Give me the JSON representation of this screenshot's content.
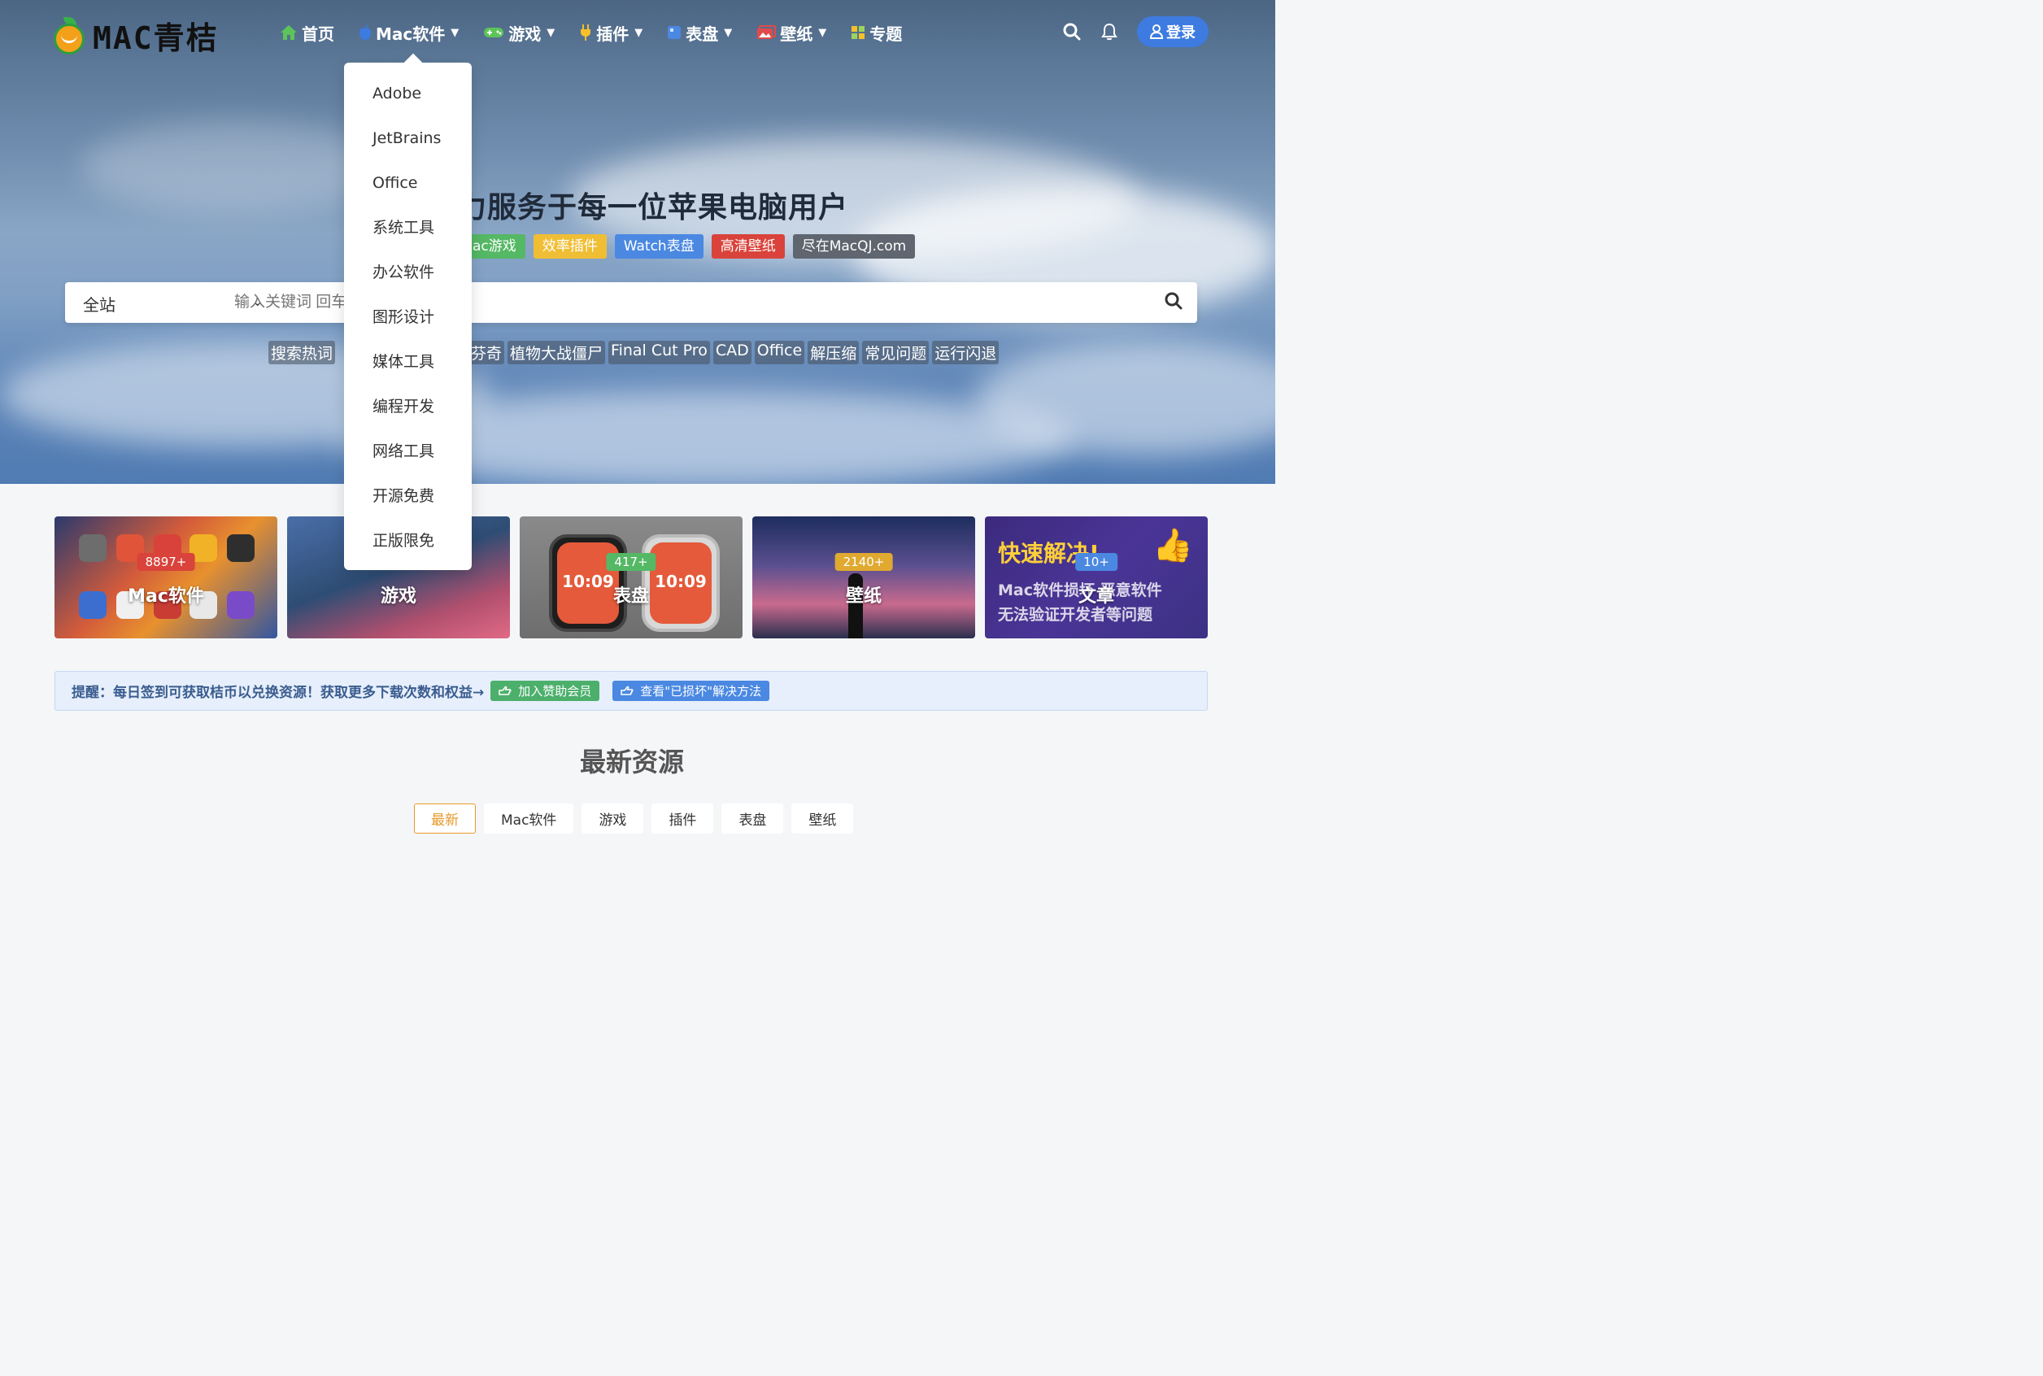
{
  "brand": {
    "name": "MAC青桔"
  },
  "nav": {
    "items": [
      {
        "label": "首页",
        "icon": "home-icon",
        "color": "#5cc55a",
        "has_dropdown": false
      },
      {
        "label": "Mac软件",
        "icon": "apple-icon",
        "color": "#3d7be0",
        "has_dropdown": true
      },
      {
        "label": "游戏",
        "icon": "gamepad-icon",
        "color": "#5cc55a",
        "has_dropdown": true
      },
      {
        "label": "插件",
        "icon": "plug-icon",
        "color": "#f5c02a",
        "has_dropdown": true
      },
      {
        "label": "表盘",
        "icon": "watch-icon",
        "color": "#4a88e2",
        "has_dropdown": true
      },
      {
        "label": "壁纸",
        "icon": "wallpaper-icon",
        "color": "#e04a4a",
        "has_dropdown": true
      },
      {
        "label": "专题",
        "icon": "grid-icon",
        "color": "#f5c02a",
        "has_dropdown": false
      }
    ],
    "login_label": "登录"
  },
  "dropdown": {
    "items": [
      "Adobe",
      "JetBrains",
      "Office",
      "系统工具",
      "办公软件",
      "图形设计",
      "媒体工具",
      "编程开发",
      "网络工具",
      "开源免费",
      "正版限免"
    ]
  },
  "hero": {
    "title_visible": "全力服务于每一位苹果电脑用户",
    "tags": [
      {
        "label": "ac游戏",
        "color": "#55b865"
      },
      {
        "label": "效率插件",
        "color": "#f0be34"
      },
      {
        "label": "Watch表盘",
        "color": "#4a88e2"
      },
      {
        "label": "高清壁纸",
        "color": "#d9433b"
      },
      {
        "label": "尽在MacQJ.com",
        "color": "#5f6670"
      }
    ]
  },
  "search": {
    "scope": "全站",
    "placeholder": "输入关键词 回车"
  },
  "hotwords": {
    "label": "搜索热词",
    "items": [
      "芬奇",
      "植物大战僵尸",
      "Final Cut Pro",
      "CAD",
      "Office",
      "解压缩",
      "常见问题",
      "运行闪退"
    ]
  },
  "categories": [
    {
      "label": "Mac软件",
      "count": "8897+",
      "badge_color": "#d9433b"
    },
    {
      "label": "游戏",
      "count": "",
      "badge_color": ""
    },
    {
      "label": "表盘",
      "count": "417+",
      "badge_color": "#55b865"
    },
    {
      "label": "壁纸",
      "count": "2140+",
      "badge_color": "#e0a930"
    },
    {
      "label": "文章",
      "count": "10+",
      "badge_color": "#4a88e2"
    }
  ],
  "card_watch": {
    "time": "10:09"
  },
  "card_article": {
    "headline": "快速解决!",
    "line1": "Mac软件损坏 恶意软件",
    "line2": "无法验证开发者等问题"
  },
  "notice": {
    "text": "提醒：每日签到可获取桔币以兑换资源！获取更多下载次数和权益→",
    "btn_member": "加入赞助会员",
    "btn_fix": "查看\"已损坏\"解决方法"
  },
  "latest": {
    "title": "最新资源",
    "tabs": [
      "最新",
      "Mac软件",
      "游戏",
      "插件",
      "表盘",
      "壁纸"
    ],
    "active_tab": "最新"
  }
}
